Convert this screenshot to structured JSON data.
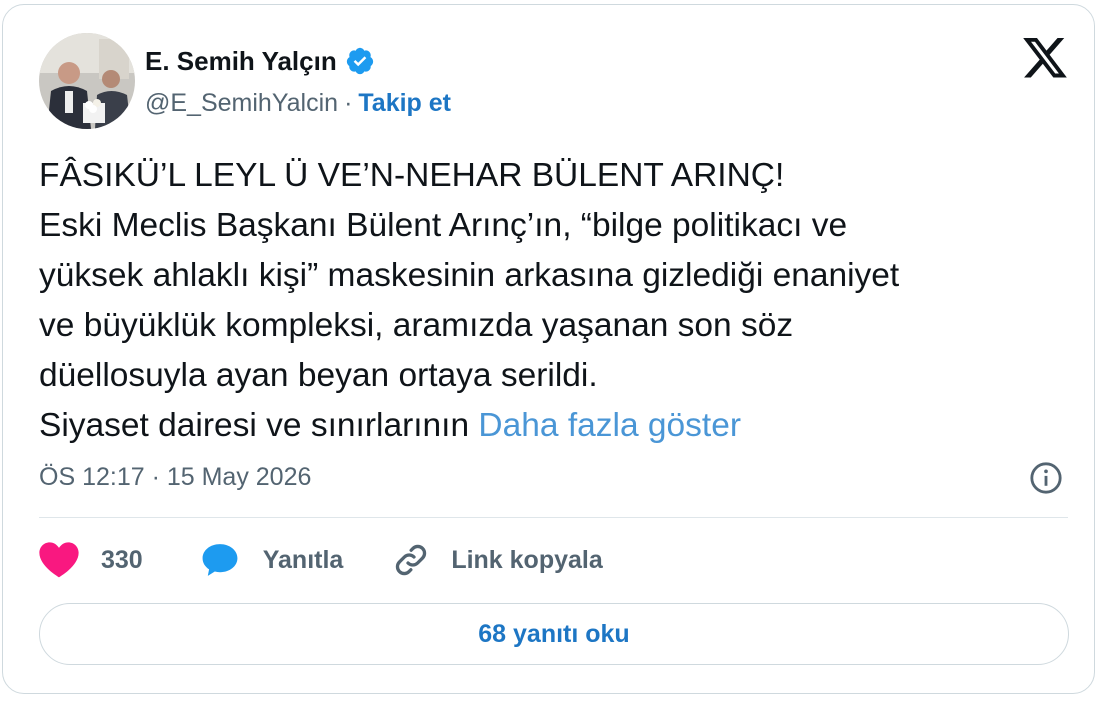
{
  "author": {
    "name": "E. Semih Yalçın",
    "handle": "@E_SemihYalcin",
    "separator": "·",
    "follow_label": "Takip et",
    "verified": true
  },
  "tweet": {
    "lines": [
      "FÂSIKÜ’L LEYL Ü VE’N-NEHAR BÜLENT ARINÇ!",
      "Eski Meclis Başkanı Bülent Arınç’ın, “bilge politikacı ve",
      "yüksek ahlaklı kişi” maskesinin arkasına gizlediği enaniyet",
      "ve büyüklük kompleksi, aramızda yaşanan son söz",
      "düellosuyla ayan beyan ortaya serildi.",
      "Siyaset dairesi ve sınırlarının"
    ],
    "show_more": "Daha fazla göster",
    "timestamp": "ÖS 12:17 · 15 May 2026"
  },
  "actions": {
    "like_count": "330",
    "reply_label": "Yanıtla",
    "copy_link_label": "Link kopyala"
  },
  "read_replies_label": "68 yanıtı oku",
  "icons": {
    "logo": "x-logo-icon",
    "verified": "verified-badge-icon",
    "info": "info-icon",
    "like": "heart-icon",
    "reply": "speech-bubble-icon",
    "copy_link": "link-icon"
  },
  "colors": {
    "link": "#1d76c4",
    "show_more": "#4a96d6",
    "heart": "#f91880",
    "reply_icon": "#1d9bf0",
    "secondary_text": "#536471",
    "border": "#cfd9de"
  }
}
